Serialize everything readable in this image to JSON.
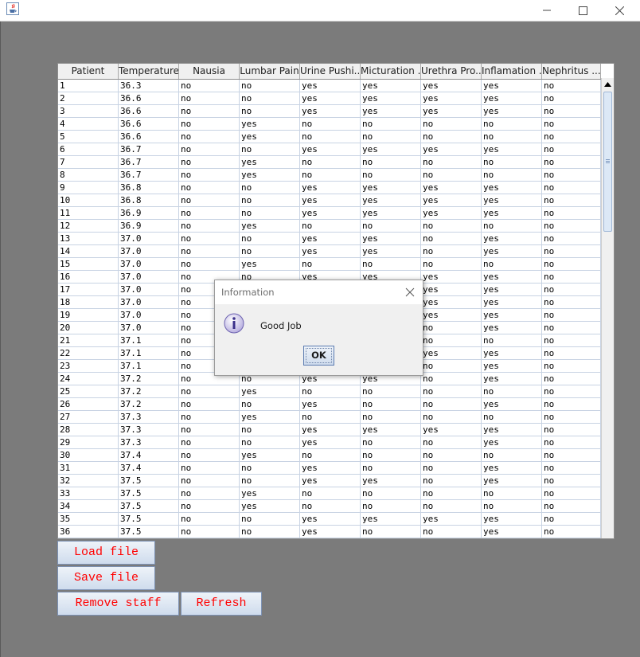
{
  "window": {
    "app_icon": "java-cup-icon"
  },
  "table": {
    "headers": [
      "Patient",
      "Temperature",
      "Nausia",
      "Lumbar Pain",
      "Urine Pushi...",
      "Micturation ...",
      "Urethra Pro...",
      "Inflamation ...",
      "Nephritus ..."
    ],
    "rows": [
      [
        "1",
        "36.3",
        "no",
        "no",
        "yes",
        "yes",
        "yes",
        "yes",
        "no"
      ],
      [
        "2",
        "36.6",
        "no",
        "no",
        "yes",
        "yes",
        "yes",
        "yes",
        "no"
      ],
      [
        "3",
        "36.6",
        "no",
        "no",
        "yes",
        "yes",
        "yes",
        "yes",
        "no"
      ],
      [
        "4",
        "36.6",
        "no",
        "yes",
        "no",
        "no",
        "no",
        "no",
        "no"
      ],
      [
        "5",
        "36.6",
        "no",
        "yes",
        "no",
        "no",
        "no",
        "no",
        "no"
      ],
      [
        "6",
        "36.7",
        "no",
        "no",
        "yes",
        "yes",
        "yes",
        "yes",
        "no"
      ],
      [
        "7",
        "36.7",
        "no",
        "yes",
        "no",
        "no",
        "no",
        "no",
        "no"
      ],
      [
        "8",
        "36.7",
        "no",
        "yes",
        "no",
        "no",
        "no",
        "no",
        "no"
      ],
      [
        "9",
        "36.8",
        "no",
        "no",
        "yes",
        "yes",
        "yes",
        "yes",
        "no"
      ],
      [
        "10",
        "36.8",
        "no",
        "no",
        "yes",
        "yes",
        "yes",
        "yes",
        "no"
      ],
      [
        "11",
        "36.9",
        "no",
        "no",
        "yes",
        "yes",
        "yes",
        "yes",
        "no"
      ],
      [
        "12",
        "36.9",
        "no",
        "yes",
        "no",
        "no",
        "no",
        "no",
        "no"
      ],
      [
        "13",
        "37.0",
        "no",
        "no",
        "yes",
        "yes",
        "no",
        "yes",
        "no"
      ],
      [
        "14",
        "37.0",
        "no",
        "no",
        "yes",
        "yes",
        "no",
        "yes",
        "no"
      ],
      [
        "15",
        "37.0",
        "no",
        "yes",
        "no",
        "no",
        "no",
        "no",
        "no"
      ],
      [
        "16",
        "37.0",
        "no",
        "no",
        "yes",
        "yes",
        "yes",
        "yes",
        "no"
      ],
      [
        "17",
        "37.0",
        "no",
        "",
        "",
        "",
        "yes",
        "yes",
        "no"
      ],
      [
        "18",
        "37.0",
        "no",
        "",
        "",
        "",
        "yes",
        "yes",
        "no"
      ],
      [
        "19",
        "37.0",
        "no",
        "",
        "",
        "",
        "yes",
        "yes",
        "no"
      ],
      [
        "20",
        "37.0",
        "no",
        "",
        "",
        "",
        "no",
        "yes",
        "no"
      ],
      [
        "21",
        "37.1",
        "no",
        "",
        "",
        "",
        "no",
        "no",
        "no"
      ],
      [
        "22",
        "37.1",
        "no",
        "",
        "",
        "",
        "yes",
        "yes",
        "no"
      ],
      [
        "23",
        "37.1",
        "no",
        "",
        "",
        "",
        "no",
        "yes",
        "no"
      ],
      [
        "24",
        "37.2",
        "no",
        "no",
        "yes",
        "yes",
        "no",
        "yes",
        "no"
      ],
      [
        "25",
        "37.2",
        "no",
        "yes",
        "no",
        "no",
        "no",
        "no",
        "no"
      ],
      [
        "26",
        "37.2",
        "no",
        "no",
        "yes",
        "no",
        "no",
        "yes",
        "no"
      ],
      [
        "27",
        "37.3",
        "no",
        "yes",
        "no",
        "no",
        "no",
        "no",
        "no"
      ],
      [
        "28",
        "37.3",
        "no",
        "no",
        "yes",
        "yes",
        "yes",
        "yes",
        "no"
      ],
      [
        "29",
        "37.3",
        "no",
        "no",
        "yes",
        "no",
        "no",
        "yes",
        "no"
      ],
      [
        "30",
        "37.4",
        "no",
        "yes",
        "no",
        "no",
        "no",
        "no",
        "no"
      ],
      [
        "31",
        "37.4",
        "no",
        "no",
        "yes",
        "no",
        "no",
        "yes",
        "no"
      ],
      [
        "32",
        "37.5",
        "no",
        "no",
        "yes",
        "yes",
        "no",
        "yes",
        "no"
      ],
      [
        "33",
        "37.5",
        "no",
        "yes",
        "no",
        "no",
        "no",
        "no",
        "no"
      ],
      [
        "34",
        "37.5",
        "no",
        "yes",
        "no",
        "no",
        "no",
        "no",
        "no"
      ],
      [
        "35",
        "37.5",
        "no",
        "no",
        "yes",
        "yes",
        "yes",
        "yes",
        "no"
      ],
      [
        "36",
        "37.5",
        "no",
        "no",
        "yes",
        "no",
        "no",
        "yes",
        "no"
      ]
    ]
  },
  "buttons": {
    "load_file": "Load file",
    "save_file": "Save file",
    "remove_staff": "Remove staff",
    "refresh": "Refresh"
  },
  "dialog": {
    "title": "Information",
    "message": "Good Job",
    "ok_label": "OK",
    "icon": "info-icon"
  },
  "colors": {
    "background": "#7b7b7b",
    "button_text": "#ff0000",
    "grid_line": "#c8d3e3"
  }
}
